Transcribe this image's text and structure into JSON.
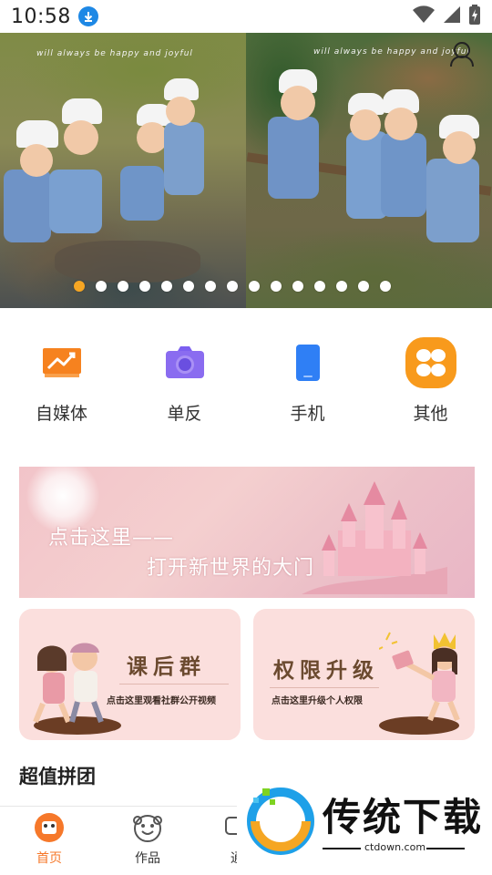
{
  "status_bar": {
    "time": "10:58",
    "download_icon": "download-icon",
    "wifi_icon": "wifi-icon",
    "signal_icon": "signal-icon",
    "battery_icon": "battery-charging-icon"
  },
  "banner": {
    "caption_left": "will always be happy and joyful",
    "caption_right": "will always be happy and joyful",
    "slide_count": 15,
    "active_slide": 1,
    "dot_color_active": "#f6a623",
    "dot_color_inactive": "#ffffff"
  },
  "categories": [
    {
      "label": "自媒体",
      "icon": "trend-chart-icon",
      "color": "#f6821f"
    },
    {
      "label": "单反",
      "icon": "camera-icon",
      "color": "#8a6cf0"
    },
    {
      "label": "手机",
      "icon": "phone-icon",
      "color": "#2f7ff5"
    },
    {
      "label": "其他",
      "icon": "grid-petals-icon",
      "color": "#f89a1c"
    }
  ],
  "promo": {
    "line1": "点击这里——",
    "line2": "打开新世界的大门"
  },
  "cards": [
    {
      "title": "课后群",
      "subtitle": "点击这里观看社群公开视频"
    },
    {
      "title": "权限升级",
      "subtitle": "点击这里升级个人权限"
    }
  ],
  "section": {
    "title": "超值拼团"
  },
  "tabbar": {
    "items": [
      {
        "label": "首页",
        "icon": "home-avatar-icon",
        "active": true
      },
      {
        "label": "作品",
        "icon": "smiley-face-icon",
        "active": false
      },
      {
        "label": "通",
        "icon": "chat-icon",
        "active": false
      }
    ],
    "active_color": "#f6782a"
  },
  "watermark": {
    "text": "传统下载",
    "url": "ctdown.com"
  }
}
